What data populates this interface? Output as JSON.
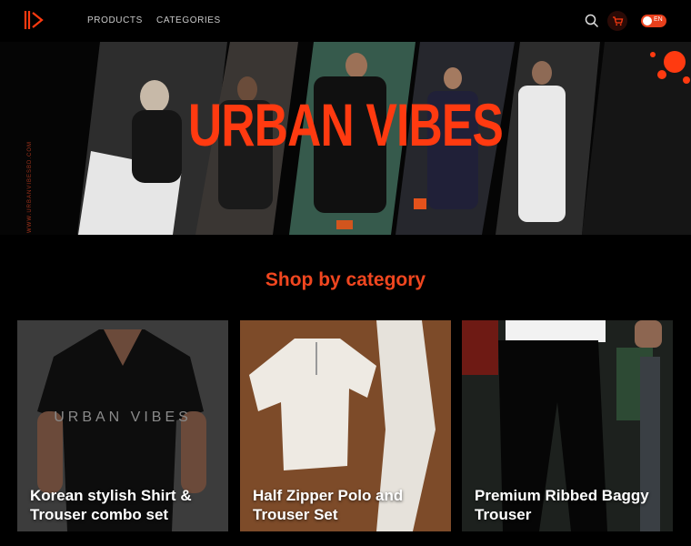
{
  "header": {
    "nav": [
      {
        "label": "PRODUCTS"
      },
      {
        "label": "CATEGORIES"
      }
    ],
    "language": "EN",
    "icons": [
      "logo-icon",
      "search-icon",
      "cart-icon"
    ],
    "colors": {
      "accent": "#ff3a10"
    }
  },
  "hero": {
    "title": "URBAN VIBES",
    "side_text": "WWW.URBANVIBESBD.COM"
  },
  "section": {
    "title": "Shop by category"
  },
  "categories": [
    {
      "title": "Korean stylish Shirt & Trouser combo set",
      "image_text": "URBAN VIBES"
    },
    {
      "title": "Half Zipper Polo and Trouser Set"
    },
    {
      "title": "Premium Ribbed Baggy Trouser"
    }
  ]
}
